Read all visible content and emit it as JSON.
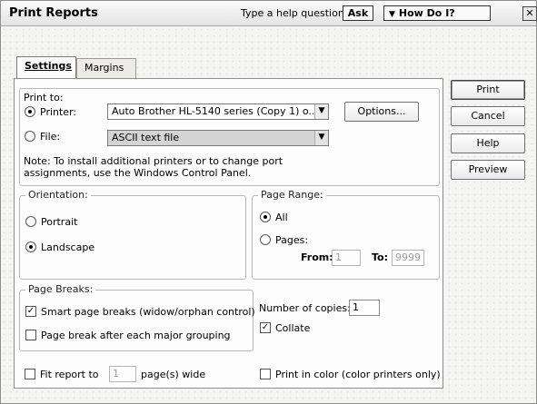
{
  "window": {
    "title": "Print Reports",
    "help_prompt": "Type a help question",
    "ask_label": "Ask",
    "how_do_label": "How Do I?",
    "close_glyph": "✕"
  },
  "tabs": [
    {
      "label": "Settings",
      "active": true
    },
    {
      "label": "Margins",
      "active": false
    }
  ],
  "print_to": {
    "label": "Print to:",
    "printer_label": "Printer:",
    "printer_value": "Auto Brother HL-5140 series (Copy 1) o...",
    "printer_selected": true,
    "options_label": "Options...",
    "file_label": "File:",
    "file_value": "ASCII text file",
    "file_selected": false,
    "note": "Note: To install additional printers or to change port\n        assignments, use the Windows Control Panel."
  },
  "orientation": {
    "label": "Orientation:",
    "portrait_label": "Portrait",
    "landscape_label": "Landscape",
    "selected": "Landscape"
  },
  "page_range": {
    "label": "Page Range:",
    "all_label": "All",
    "pages_label": "Pages:",
    "from_label": "From:",
    "from_value": "1",
    "to_label": "To:",
    "to_value": "9999",
    "selected": "All"
  },
  "page_breaks": {
    "label": "Page Breaks:",
    "smart_label": "Smart page breaks (widow/orphan control)",
    "smart_checked": true,
    "major_label": "Page break after each major grouping",
    "major_checked": false
  },
  "copies": {
    "label": "Number of copies:",
    "value": "1",
    "collate_label": "Collate",
    "collate_checked": true
  },
  "fit_report": {
    "prefix_label": "Fit report to",
    "value": "1",
    "suffix_label": "page(s) wide",
    "checked": false
  },
  "color": {
    "label": "Print in color (color printers only)",
    "checked": false
  },
  "buttons": {
    "print": "Print",
    "cancel": "Cancel",
    "help": "Help",
    "preview": "Preview"
  },
  "icons": {
    "dropdown": "chevron-down-icon",
    "check": "checkmark-icon",
    "how_do_arrow": "triangle-down-icon"
  }
}
